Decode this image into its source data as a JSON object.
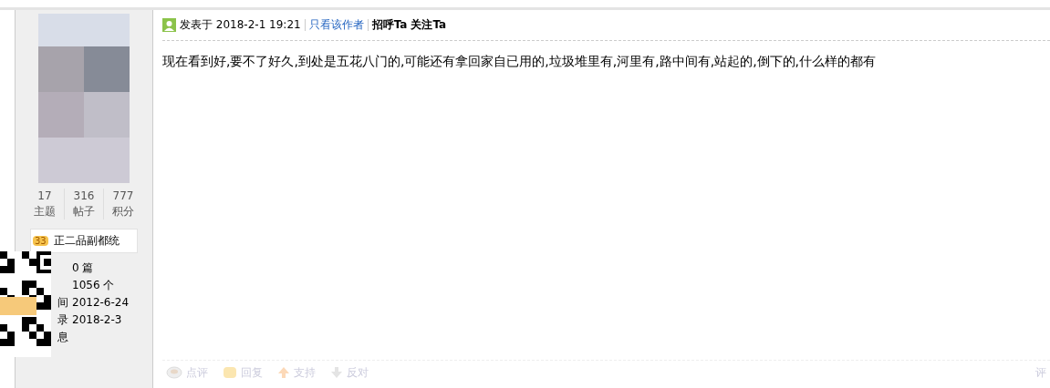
{
  "author": {
    "stats": [
      {
        "value": "17",
        "label": "主题"
      },
      {
        "value": "316",
        "label": "帖子"
      },
      {
        "value": "777",
        "label": "积分"
      }
    ],
    "medal": {
      "number": "33",
      "title": "正二品副都统"
    },
    "info": [
      {
        "value": "0 篇"
      },
      {
        "value": "1056 个"
      },
      {
        "label": "间",
        "value": "2012-6-24"
      },
      {
        "label": "录",
        "value": "2018-2-3"
      },
      {
        "label": "息"
      }
    ]
  },
  "post": {
    "posted": "发表于 2018-2-1 19:21",
    "only_author": "只看该作者",
    "greet": "招呼Ta",
    "follow": "关注Ta",
    "body": "现在看到好,要不了好久,到处是五花八门的,可能还有拿回家自已用的,垃圾堆里有,河里有,路中间有,站起的,倒下的,什么样的都有",
    "actions": [
      {
        "kind": "comment",
        "label": "点评"
      },
      {
        "kind": "reply",
        "label": "回复"
      },
      {
        "kind": "support",
        "label": "支持"
      },
      {
        "kind": "oppose",
        "label": "反对"
      }
    ],
    "rate": "评"
  }
}
